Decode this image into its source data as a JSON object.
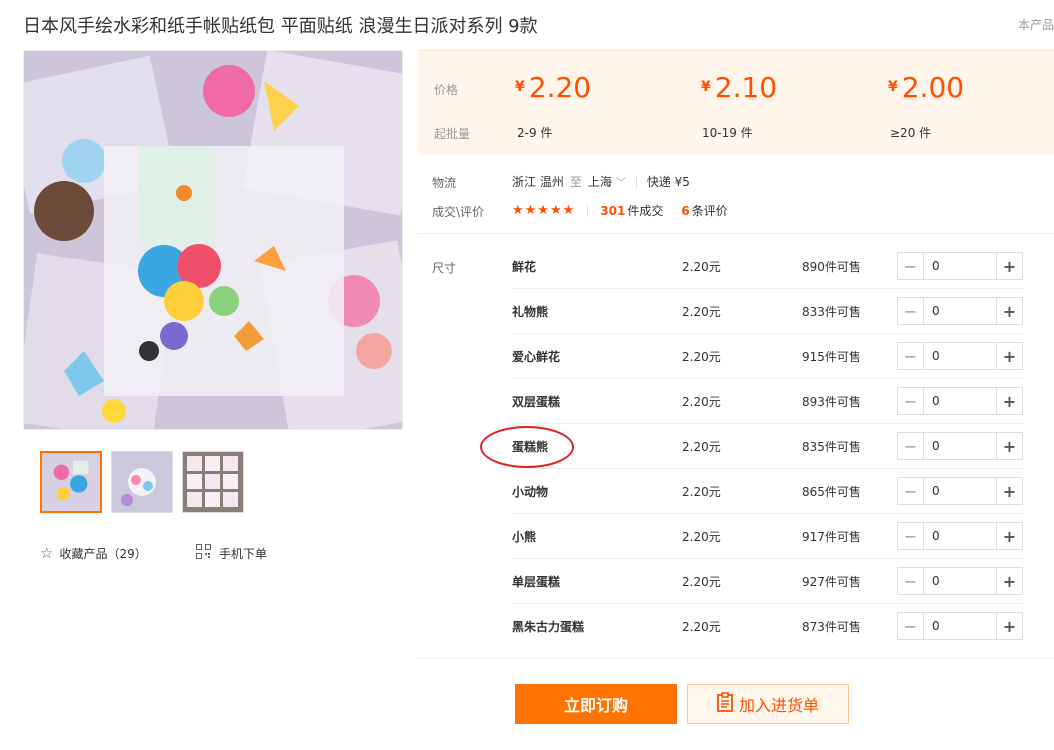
{
  "product": {
    "title": "日本风手绘水彩和纸手帐贴纸包 平面贴纸 浪漫生日派对系列 9款",
    "corner_text": "本产品"
  },
  "gallery": {
    "thumbnail_count": 3,
    "active_index": 0
  },
  "actions": {
    "favorite_label": "收藏产品（29）",
    "mobile_order_label": "手机下单"
  },
  "pricing": {
    "price_label": "价格",
    "batch_label": "起批量",
    "currency": "¥",
    "tiers": [
      {
        "price": "2.20",
        "range": "2-9 件"
      },
      {
        "price": "2.10",
        "range": "10-19 件"
      },
      {
        "price": "2.00",
        "range": "≥20 件"
      }
    ]
  },
  "logistics": {
    "label": "物流",
    "from": "浙江 温州",
    "to_word": "至",
    "to": "上海",
    "shipping": "快递 ¥5"
  },
  "deals": {
    "label": "成交\\评价",
    "stars": "★★★★★",
    "sold_count": "301",
    "sold_suffix": "件成交",
    "review_count": "6",
    "review_suffix": "条评价"
  },
  "sku": {
    "label": "尺寸",
    "rows": [
      {
        "name": "鲜花",
        "price": "2.20元",
        "stock": "890件可售",
        "qty": "0"
      },
      {
        "name": "礼物熊",
        "price": "2.20元",
        "stock": "833件可售",
        "qty": "0"
      },
      {
        "name": "爱心鲜花",
        "price": "2.20元",
        "stock": "915件可售",
        "qty": "0"
      },
      {
        "name": "双层蛋糕",
        "price": "2.20元",
        "stock": "893件可售",
        "qty": "0"
      },
      {
        "name": "蛋糕熊",
        "price": "2.20元",
        "stock": "835件可售",
        "qty": "0"
      },
      {
        "name": "小动物",
        "price": "2.20元",
        "stock": "865件可售",
        "qty": "0"
      },
      {
        "name": "小熊",
        "price": "2.20元",
        "stock": "917件可售",
        "qty": "0"
      },
      {
        "name": "单层蛋糕",
        "price": "2.20元",
        "stock": "927件可售",
        "qty": "0"
      },
      {
        "name": "黑朱古力蛋糕",
        "price": "2.20元",
        "stock": "873件可售",
        "qty": "0"
      }
    ]
  },
  "buttons": {
    "buy_now": "立即订购",
    "add_to_list": "加入进货单"
  },
  "colors": {
    "accent": "#ff7300",
    "price": "#ff5000",
    "highlight_circle": "#e02020"
  }
}
